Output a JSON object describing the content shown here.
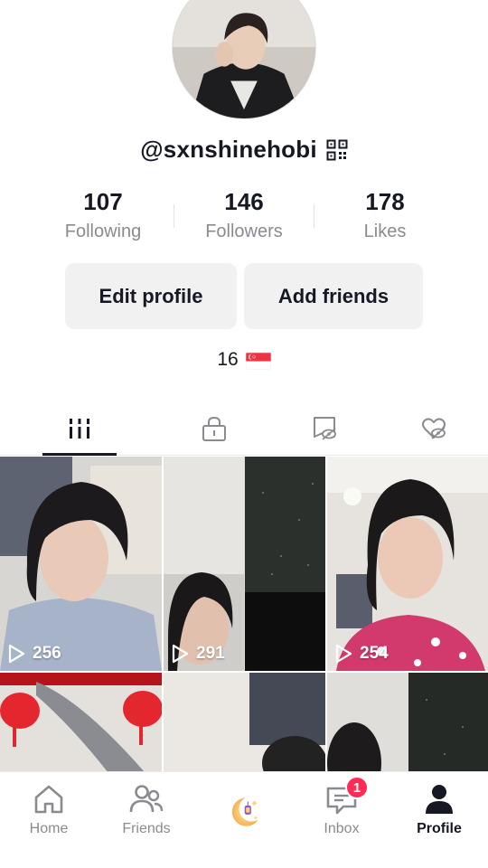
{
  "profile": {
    "username": "@sxnshinehobi",
    "bio": "16"
  },
  "stats": [
    {
      "value": "107",
      "label": "Following"
    },
    {
      "value": "146",
      "label": "Followers"
    },
    {
      "value": "178",
      "label": "Likes"
    }
  ],
  "buttons": {
    "edit_profile": "Edit profile",
    "add_friends": "Add friends"
  },
  "tabs": [
    {
      "icon": "grid-icon",
      "active": true
    },
    {
      "icon": "lock-icon",
      "active": false
    },
    {
      "icon": "hidden-repost-icon",
      "active": false
    },
    {
      "icon": "hidden-heart-icon",
      "active": false
    }
  ],
  "videos": [
    {
      "views": "256"
    },
    {
      "views": "291"
    },
    {
      "views": "254"
    },
    {
      "views": ""
    },
    {
      "views": ""
    },
    {
      "views": ""
    }
  ],
  "nav": {
    "home": "Home",
    "friends": "Friends",
    "inbox": "Inbox",
    "inbox_badge": "1",
    "profile": "Profile"
  },
  "colors": {
    "accent": "#fe2c55",
    "text": "#161823",
    "muted": "#8a8b91",
    "button_bg": "#f1f1f2"
  }
}
